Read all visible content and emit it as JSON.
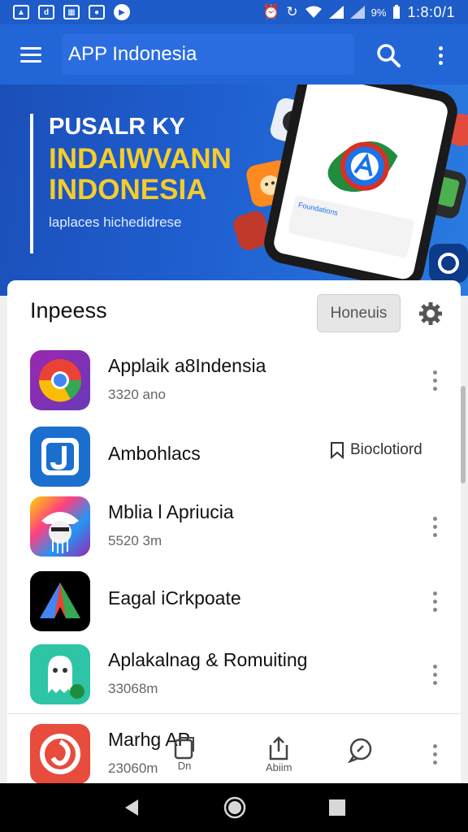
{
  "status_bar": {
    "battery": "9%",
    "time": "1:8:0/1"
  },
  "toolbar": {
    "title": "APP Indonesia",
    "search_icon": "search-icon",
    "more_icon": "more-vert-icon"
  },
  "banner": {
    "line1": "PUSALR KY",
    "line2": "INDAIWVANN",
    "line3": "INDONESIA",
    "subtitle": "laplaces hichedidrese",
    "phone_card_text": "Foundations"
  },
  "section": {
    "title": "Inpeess",
    "filter_label": "Honeuis"
  },
  "apps": [
    {
      "name": "Applaik a8Indensia",
      "size": "3320 ano",
      "icon": "chrome-style-icon"
    },
    {
      "name": "Ambohlacs",
      "size": "",
      "icon": "blue-j-icon",
      "action_label": "Bioclotiord"
    },
    {
      "name": "Mblia l Apriucia",
      "size": "5520 3m",
      "icon": "masked-character-icon"
    },
    {
      "name": "Eagal iCrkpoate",
      "size": "",
      "icon": "triangle-logo-icon"
    },
    {
      "name": "Aplakalnag & Romuiting",
      "size": "33068m",
      "icon": "ghost-icon"
    },
    {
      "name": "Marhg AP",
      "size": "23060m",
      "icon": "red-spiral-icon"
    }
  ],
  "bottom_tabs": [
    {
      "label": "Dn",
      "icon": "copy-icon"
    },
    {
      "label": "Abiim",
      "icon": "share-icon"
    },
    {
      "label": "",
      "icon": "chat-icon"
    }
  ],
  "nav": {
    "back": "back-icon",
    "home": "home-icon",
    "recents": "recents-icon"
  }
}
